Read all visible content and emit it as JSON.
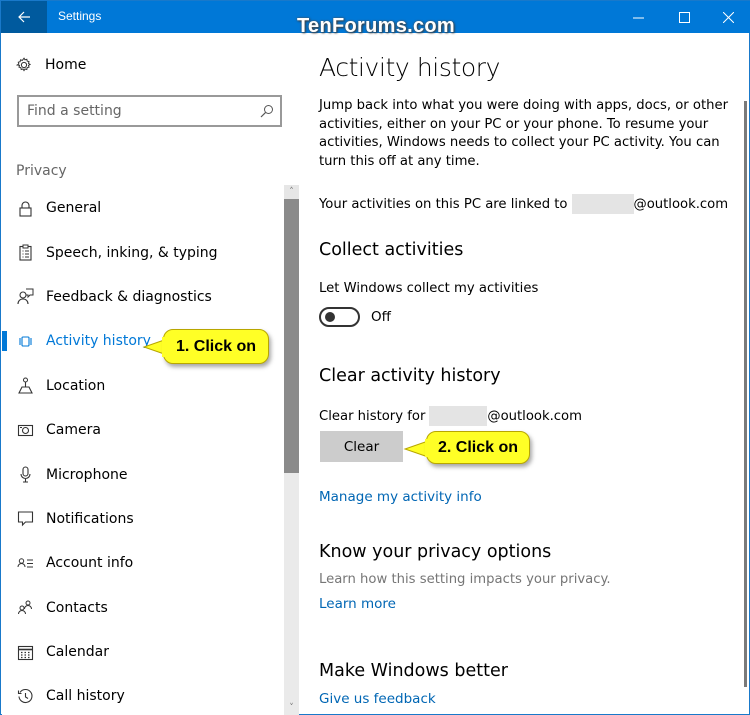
{
  "window": {
    "title": "Settings",
    "watermark": "TenForums.com",
    "accent_color": "#0078d7"
  },
  "titlebar": {
    "back_icon": "arrow-left-icon",
    "minimize_icon": "minimize-icon",
    "maximize_icon": "maximize-icon",
    "close_icon": "close-icon"
  },
  "sidebar": {
    "home_label": "Home",
    "home_icon": "gear-icon",
    "search_placeholder": "Find a setting",
    "search_icon": "search-icon",
    "section_label": "Privacy",
    "items": [
      {
        "label": "General",
        "icon": "lock-icon",
        "active": false
      },
      {
        "label": "Speech, inking, & typing",
        "icon": "clipboard-icon",
        "active": false
      },
      {
        "label": "Feedback & diagnostics",
        "icon": "feedback-icon",
        "active": false
      },
      {
        "label": "Activity history",
        "icon": "activity-icon",
        "active": true
      },
      {
        "label": "Location",
        "icon": "location-icon",
        "active": false
      },
      {
        "label": "Camera",
        "icon": "camera-icon",
        "active": false
      },
      {
        "label": "Microphone",
        "icon": "microphone-icon",
        "active": false
      },
      {
        "label": "Notifications",
        "icon": "notification-icon",
        "active": false
      },
      {
        "label": "Account info",
        "icon": "account-info-icon",
        "active": false
      },
      {
        "label": "Contacts",
        "icon": "contacts-icon",
        "active": false
      },
      {
        "label": "Calendar",
        "icon": "calendar-icon",
        "active": false
      },
      {
        "label": "Call history",
        "icon": "history-icon",
        "active": false
      }
    ]
  },
  "callouts": {
    "step1": "1. Click on",
    "step2": "2. Click on"
  },
  "main": {
    "title": "Activity history",
    "description": "Jump back into what you were doing with apps, docs, or other activities, either on your PC or your phone. To resume your activities, Windows needs to collect your PC activity. You can turn this off at any time.",
    "linked_prefix": "Your activities on this PC are linked to",
    "email_domain": "@outlook.com",
    "collect": {
      "heading": "Collect activities",
      "toggle_label": "Let Windows collect my activities",
      "toggle_state": "Off"
    },
    "clear": {
      "heading": "Clear activity history",
      "clear_for_prefix": "Clear history for",
      "button_label": "Clear",
      "manage_link": "Manage my activity info"
    },
    "privacy": {
      "heading": "Know your privacy options",
      "subtext": "Learn how this setting impacts your privacy.",
      "link": "Learn more"
    },
    "better": {
      "heading": "Make Windows better",
      "link": "Give us feedback"
    }
  }
}
